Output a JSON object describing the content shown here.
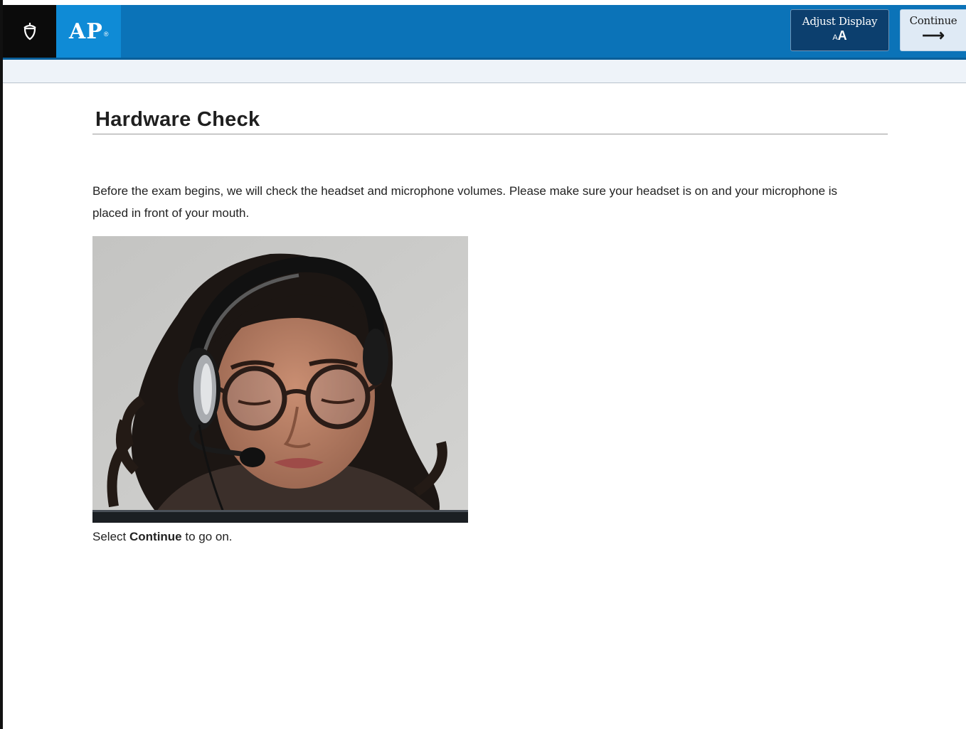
{
  "header": {
    "brand_icon": "acorn-icon",
    "ap_logo_text": "AP",
    "ap_logo_mark": "®",
    "adjust_display": {
      "label": "Adjust Display",
      "icon_small": "A",
      "icon_large": "A"
    },
    "continue_button": {
      "label": "Continue",
      "arrow": "⟶"
    }
  },
  "main": {
    "title": "Hardware Check",
    "intro": "Before the exam begins, we will check the headset and microphone volumes. Please make sure your headset is on and your microphone is placed in front of your mouth.",
    "photo_subject": "student wearing headset with microphone",
    "select_prefix": "Select ",
    "select_bold": "Continue",
    "select_suffix": " to go on."
  },
  "colors": {
    "topbar": "#0b73b8",
    "ap_logo_bg": "#0f8bd6",
    "adjust_bg": "#0c3f6e",
    "continue_bg": "#dfeaf5",
    "subbar": "#eef3f9"
  }
}
